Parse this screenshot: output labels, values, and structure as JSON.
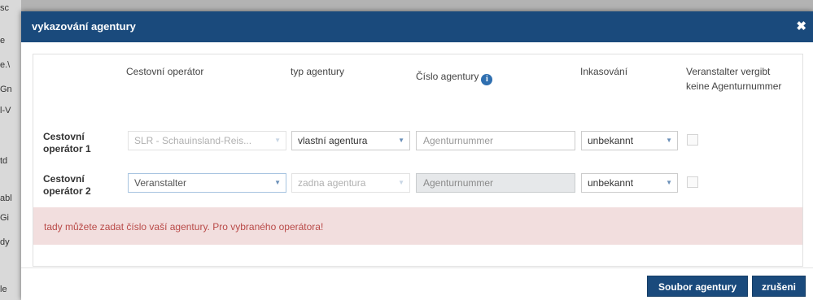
{
  "background": {
    "fragments": [
      "sc",
      "e",
      "e.\\",
      "Gn",
      "l-V",
      "td",
      "abl",
      "Gi",
      "dy",
      "le"
    ]
  },
  "dialog": {
    "title": "vykazování agentury",
    "close_icon": "close-icon",
    "columns": {
      "operator": "Cestovní operátor",
      "agency_type": "typ agentury",
      "agency_number": "Číslo agentury",
      "collection": "Inkasování",
      "no_number": "Veranstalter vergibt keine Agenturnummer"
    },
    "rows": [
      {
        "label_line1": "Cestovní",
        "label_line2": "operátor 1",
        "operator": "SLR - Schauinsland-Reis...",
        "agency_type": "vlastní agentura",
        "agency_number_placeholder": "Agenturnummer",
        "collection": "unbekannt"
      },
      {
        "label_line1": "Cestovní",
        "label_line2": "operátor 2",
        "operator": "Veranstalter",
        "agency_type": "zadna agentura",
        "agency_number_placeholder": "Agenturnummer",
        "collection": "unbekannt"
      }
    ],
    "alert": "tady můžete zadat číslo vaší agentury. Pro vybraného operátora!",
    "buttons": {
      "submit": "Soubor agentury",
      "cancel": "zrušeni"
    },
    "colors": {
      "header": "#1a4a7c",
      "alert_bg": "#f2dede",
      "alert_text": "#b94a48"
    }
  }
}
